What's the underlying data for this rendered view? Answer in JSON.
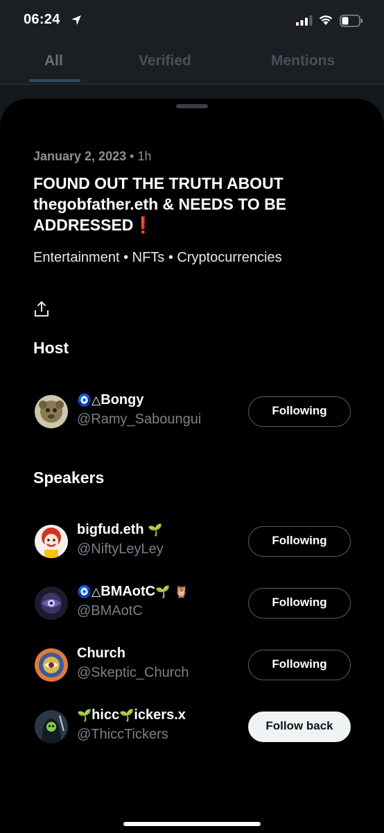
{
  "status_bar": {
    "time": "06:24"
  },
  "tabs": [
    {
      "label": "All",
      "active": true
    },
    {
      "label": "Verified",
      "active": false
    },
    {
      "label": "Mentions",
      "active": false
    }
  ],
  "space": {
    "date": "January 2, 2023",
    "elapsed": "1h",
    "title": "FOUND OUT THE TRUTH ABOUT thegobfather.eth & NEEDS TO BE ADDRESSED",
    "title_emoji": "❗",
    "topics": "Entertainment • NFTs • Cryptocurrencies"
  },
  "host_section": {
    "heading": "Host",
    "people": [
      {
        "name_prefix": "🧿△",
        "name": "Bongy",
        "handle": "@Ramy_Saboungui",
        "button": "Following",
        "avatar_color": "#a08a5a"
      }
    ]
  },
  "speakers_section": {
    "heading": "Speakers",
    "people": [
      {
        "name_prefix": "",
        "name": "bigfud.eth",
        "name_suffix": "🌱",
        "handle": "@NiftyLeyLey",
        "button": "Following",
        "avatar_color": "#d83a2e"
      },
      {
        "name_prefix": "🧿△",
        "name": "BMAotC",
        "name_suffix": "🌱 🦉",
        "handle": "@BMAotC",
        "button": "Following",
        "avatar_color": "#2c2a52"
      },
      {
        "name_prefix": "",
        "name": "Church",
        "name_suffix": "",
        "handle": "@Skeptic_Church",
        "button": "Following",
        "avatar_color": "#c45a34"
      },
      {
        "name_prefix": "🌱",
        "name": "hicc",
        "name_mid": "🌱",
        "name_end": "ickers.x",
        "handle": "@ThiccTickers",
        "button": "Follow back",
        "avatar_color": "#2b3744"
      }
    ]
  },
  "colors": {
    "sheet_bg": "#000000",
    "accent_following_border": "#5b6167",
    "follow_back_bg": "#eff3f4",
    "excl_red": "#e0242b"
  }
}
